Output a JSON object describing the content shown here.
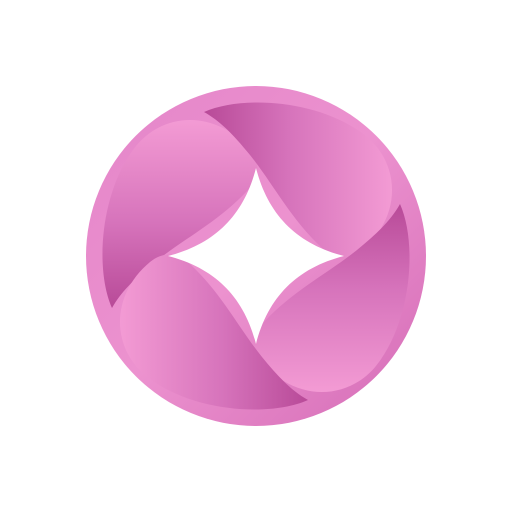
{
  "app_icon": {
    "icon": "rotating-petals-circle-logo-icon",
    "background_color": "#ffffff",
    "colors": {
      "highlight": "#f6a3d6",
      "mid": "#de79c0",
      "shadow": "#b54495",
      "deep": "#9e3683"
    }
  }
}
